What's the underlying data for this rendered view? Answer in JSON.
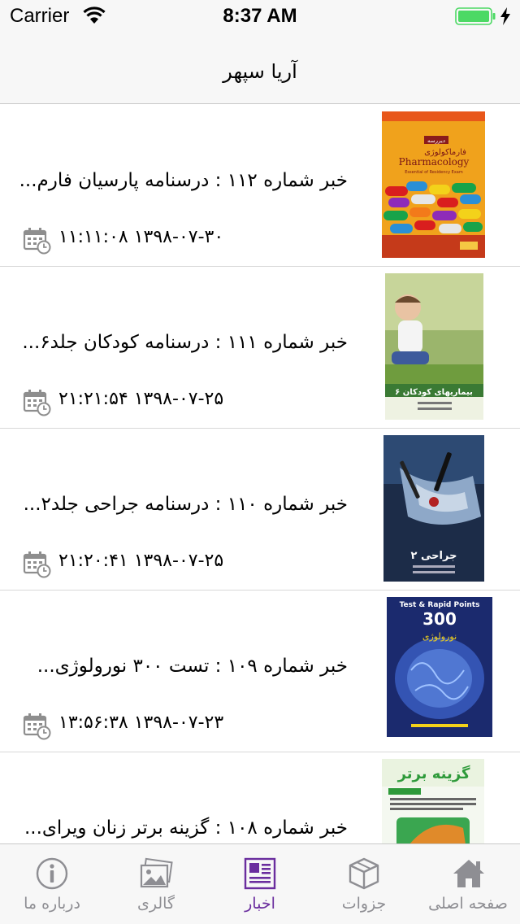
{
  "status_bar": {
    "carrier": "Carrier",
    "time": "8:37 AM"
  },
  "nav": {
    "title": "آریا سپهر"
  },
  "news": [
    {
      "title": "خبر شماره ۱۱۲ : درسنامه پارسیان فارم...",
      "date": "۱۳۹۸-۰۷-۳۰ ۱۱:۱۱:۰۸"
    },
    {
      "title": "خبر شماره ۱۱۱ : درسنامه کودکان جلد۶...",
      "date": "۱۳۹۸-۰۷-۲۵ ۲۱:۲۱:۵۴"
    },
    {
      "title": "خبر شماره ۱۱۰ : درسنامه جراحی جلد۲...",
      "date": "۱۳۹۸-۰۷-۲۵ ۲۱:۲۰:۴۱"
    },
    {
      "title": "خبر شماره ۱۰۹ : تست ۳۰۰ نورولوژی...",
      "date": "۱۳۹۸-۰۷-۲۳ ۱۳:۵۶:۳۸"
    },
    {
      "title": "خبر شماره ۱۰۸ : گزینه برتر زنان ویرای...",
      "date": ""
    }
  ],
  "book_covers": {
    "cover1": {
      "badge": "دیررسه",
      "title_fa": "فارماکولوژی",
      "title_en": "Pharmacology",
      "subtitle": "Essential of Residency Exam"
    },
    "cover2": {
      "title_fa": "بیماریهای کودکان ۶"
    },
    "cover3": {
      "title_fa": "جراحی ۲"
    },
    "cover4": {
      "header": "Test & Rapid Points",
      "number": "300",
      "title_fa": "نورولوژی"
    },
    "cover5": {
      "title_fa": "گزینه برتر"
    }
  },
  "tabs": [
    {
      "label": "درباره ما",
      "icon": "info-icon"
    },
    {
      "label": "گالری",
      "icon": "gallery-icon"
    },
    {
      "label": "اخبار",
      "icon": "news-icon",
      "active": true
    },
    {
      "label": "جزوات",
      "icon": "box-icon"
    },
    {
      "label": "صفحه اصلی",
      "icon": "home-icon"
    }
  ],
  "colors": {
    "active_tab": "#6a2d9e",
    "inactive_tab": "#8e8e93",
    "battery": "#4cd964"
  }
}
